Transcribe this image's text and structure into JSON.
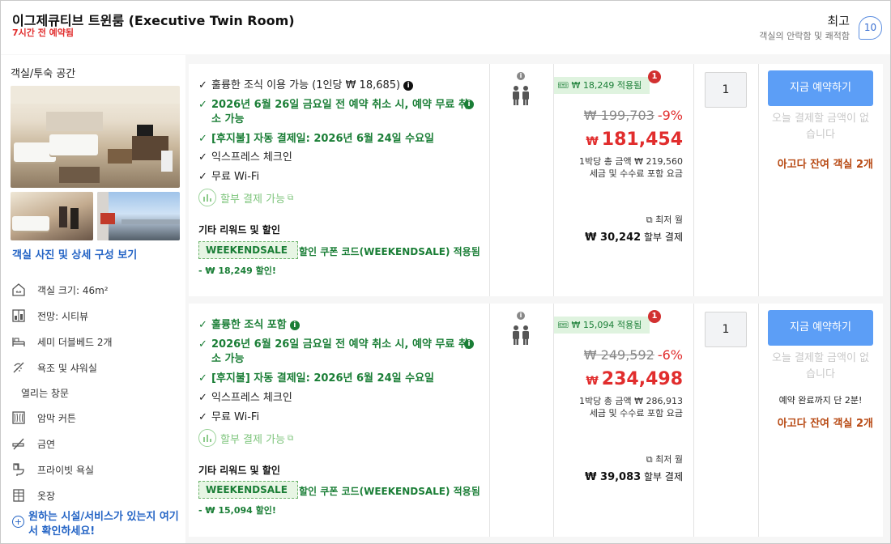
{
  "header": {
    "room_title": "이그제큐티브 트윈룸 (Executive Twin Room)",
    "booked_note": "7시간 전 예약됨",
    "rating_label": "최고",
    "rating_sub": "객실의 안락함 및 쾌적함",
    "rating_score": "10"
  },
  "room_panel": {
    "title": "객실/투숙 공간",
    "view_link": "객실 사진 및 상세 구성 보기",
    "amenities": [
      {
        "icon": "room-size-icon",
        "label": "객실 크기: 46m²"
      },
      {
        "icon": "window-view-icon",
        "label": "전망: 시티뷰"
      },
      {
        "icon": "bed-icon",
        "label": "세미 더블베드 2개"
      },
      {
        "icon": "bath-shower-icon",
        "label": "욕조 및 샤워실"
      },
      {
        "icon": "",
        "label": "열리는 창문"
      },
      {
        "icon": "blackout-curtain-icon",
        "label": "암막 커튼"
      },
      {
        "icon": "no-smoking-icon",
        "label": "금연"
      },
      {
        "icon": "private-bathroom-icon",
        "label": "프라이빗 욕실"
      },
      {
        "icon": "wardrobe-icon",
        "label": "옷장"
      }
    ],
    "ask_link": "원하는 시설/서비스가 있는지 여기서 확인하세요!"
  },
  "offers": [
    {
      "features": {
        "breakfast": "훌륭한 조식 이용 가능 (1인당 ₩ 18,685)",
        "cancel": "2026년 6월 26일 금요일 전 예약 취소 시, 예약 무료 취소 가능",
        "pay_later": "[후지불] 자동 결제일: 2026년 6월 24일 수요일",
        "express": "익스프레스 체크인",
        "wifi": "무료 Wi-Fi",
        "installment": "할부 결제 가능"
      },
      "other_title": "기타 리워드 및 할인",
      "coupon_code": "WEEKENDSALE",
      "coupon_text": "할인 쿠폰 코드(WEEKENDSALE) 적용됨",
      "discount": "- ₩ 18,249 할인!",
      "price": {
        "save_tag": "₩ 18,249 적용됨",
        "badge": "1",
        "original": "₩ 199,703",
        "pct": "-9%",
        "currency": "₩",
        "final": "181,454",
        "per_night": "1박당 총 금액 ₩ 219,560",
        "tax_note": "세금 및 수수료 포함 요금",
        "min_label": "최저 월",
        "installment_amount": "₩ 30,242",
        "installment_label": "할부 결제"
      },
      "qty": "1",
      "book_label": "지금 예약하기",
      "no_pay": "오늘 결제할 금액이 없습니다",
      "note": "",
      "rooms_left": "아고다 잔여 객실 2개"
    },
    {
      "features": {
        "breakfast": "훌륭한 조식 포함",
        "cancel": "2026년 6월 26일 금요일 전 예약 취소 시, 예약 무료 취소 가능",
        "pay_later": "[후지불] 자동 결제일: 2026년 6월 24일 수요일",
        "express": "익스프레스 체크인",
        "wifi": "무료 Wi-Fi",
        "installment": "할부 결제 가능"
      },
      "other_title": "기타 리워드 및 할인",
      "coupon_code": "WEEKENDSALE",
      "coupon_text": "할인 쿠폰 코드(WEEKENDSALE) 적용됨",
      "discount": "- ₩ 15,094 할인!",
      "price": {
        "save_tag": "₩ 15,094 적용됨",
        "badge": "1",
        "original": "₩ 249,592",
        "pct": "-6%",
        "currency": "₩",
        "final": "234,498",
        "per_night": "1박당 총 금액 ₩ 286,913",
        "tax_note": "세금 및 수수료 포함 요금",
        "min_label": "최저 월",
        "installment_amount": "₩ 39,083",
        "installment_label": "할부 결제"
      },
      "qty": "1",
      "book_label": "지금 예약하기",
      "no_pay": "오늘 결제할 금액이 없습니다",
      "note": "예약 완료까지 단 2분!",
      "rooms_left": "아고다 잔여 객실 2개"
    }
  ],
  "colors": {
    "accent_blue": "#5c9ef6",
    "price_red": "#e12d2d",
    "green": "#1a7e36",
    "urgency_orange": "#b84a14"
  }
}
